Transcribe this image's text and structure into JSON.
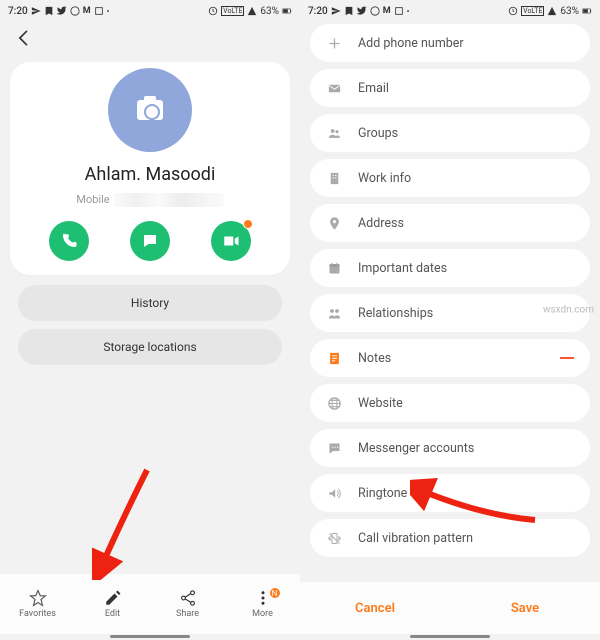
{
  "status": {
    "time": "7:20",
    "battery": "63%"
  },
  "left": {
    "name": "Ahlam. Masoodi",
    "mobile_label": "Mobile",
    "history": "History",
    "storage": "Storage locations",
    "bottom": {
      "fav": "Favorites",
      "edit": "Edit",
      "share": "Share",
      "more": "More"
    }
  },
  "right": {
    "rows": {
      "add_phone": "Add phone number",
      "email": "Email",
      "groups": "Groups",
      "work": "Work info",
      "address": "Address",
      "dates": "Important dates",
      "rel": "Relationships",
      "notes": "Notes",
      "web": "Website",
      "msg": "Messenger accounts",
      "ring": "Ringtone",
      "vib": "Call vibration pattern"
    },
    "cancel": "Cancel",
    "save": "Save"
  },
  "watermark": "wsxdn.com"
}
